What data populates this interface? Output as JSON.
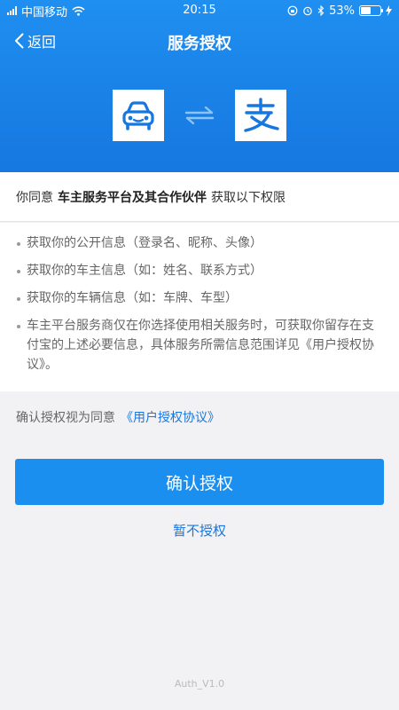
{
  "status_bar": {
    "carrier": "中国移动",
    "time": "20:15",
    "battery": "53%",
    "battery_level": 0.53
  },
  "nav": {
    "back_label": "返回",
    "title": "服务授权"
  },
  "consent": {
    "prefix": "你同意",
    "party": "车主服务平台及其合作伙伴",
    "suffix": "获取以下权限"
  },
  "permissions": [
    "获取你的公开信息（登录名、昵称、头像）",
    "获取你的车主信息（如：姓名、联系方式）",
    "获取你的车辆信息（如：车牌、车型）",
    "车主平台服务商仅在你选择使用相关服务时，可获取你留存在支付宝的上述必要信息，具体服务所需信息范围详见《用户授权协议》。"
  ],
  "agreement": {
    "text": "确认授权视为同意",
    "link": "《用户授权协议》"
  },
  "buttons": {
    "confirm": "确认授权",
    "decline": "暂不授权"
  },
  "version": "Auth_V1.0",
  "colors": {
    "primary": "#1b8ff0",
    "link": "#1677e0"
  },
  "icons": {
    "app_logo": "car-icon",
    "swap": "swap-arrows-icon",
    "alipay_logo": "alipay-icon"
  }
}
